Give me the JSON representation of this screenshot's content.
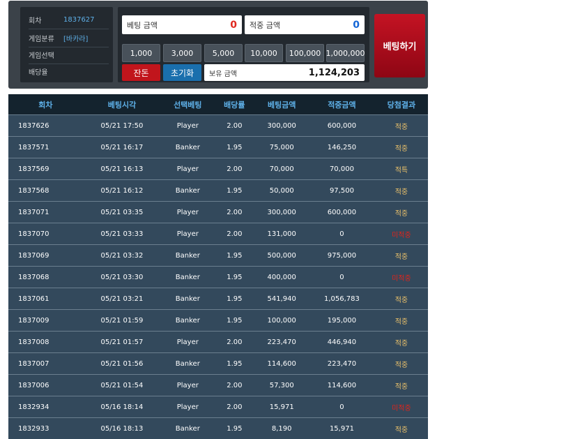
{
  "info": {
    "round_label": "회차",
    "round_value": "1837627",
    "game_type_label": "게임분류",
    "game_type_value": "[바카라]",
    "game_select_label": "게임선택",
    "odds_label": "배당율"
  },
  "bet": {
    "amount_label": "베팅 금액",
    "amount_value": "0",
    "win_label": "적중 금액",
    "win_value": "0",
    "chips": [
      "1,000",
      "3,000",
      "5,000",
      "10,000",
      "100,000",
      "1,000,000"
    ],
    "remainder_label": "잔돈",
    "reset_label": "초기화",
    "balance_label": "보유 금액",
    "balance_value": "1,124,203",
    "submit_label": "베팅하기"
  },
  "colors": {
    "amount_value": "#e0291f",
    "win_value": "#1466d6",
    "remainder_btn": "#c1151c",
    "reset_btn": "#1a6fad",
    "header_text": "#5eb0e8",
    "result_win": "#e9c06a",
    "result_loss": "#e3241a"
  },
  "history": {
    "headers": [
      "회차",
      "베팅시각",
      "선택베팅",
      "배당률",
      "베팅금액",
      "적중금액",
      "당첨결과"
    ],
    "rows": [
      {
        "round": "1837626",
        "time": "05/21 17:50",
        "pick": "Player",
        "odds": "2.00",
        "bet": "300,000",
        "win": "600,000",
        "result": "적중",
        "status": "win"
      },
      {
        "round": "1837571",
        "time": "05/21 16:17",
        "pick": "Banker",
        "odds": "1.95",
        "bet": "75,000",
        "win": "146,250",
        "result": "적중",
        "status": "win"
      },
      {
        "round": "1837569",
        "time": "05/21 16:13",
        "pick": "Player",
        "odds": "2.00",
        "bet": "70,000",
        "win": "70,000",
        "result": "적특",
        "status": "win"
      },
      {
        "round": "1837568",
        "time": "05/21 16:12",
        "pick": "Banker",
        "odds": "1.95",
        "bet": "50,000",
        "win": "97,500",
        "result": "적중",
        "status": "win"
      },
      {
        "round": "1837071",
        "time": "05/21 03:35",
        "pick": "Player",
        "odds": "2.00",
        "bet": "300,000",
        "win": "600,000",
        "result": "적중",
        "status": "win"
      },
      {
        "round": "1837070",
        "time": "05/21 03:33",
        "pick": "Player",
        "odds": "2.00",
        "bet": "131,000",
        "win": "0",
        "result": "미적중",
        "status": "loss"
      },
      {
        "round": "1837069",
        "time": "05/21 03:32",
        "pick": "Banker",
        "odds": "1.95",
        "bet": "500,000",
        "win": "975,000",
        "result": "적중",
        "status": "win"
      },
      {
        "round": "1837068",
        "time": "05/21 03:30",
        "pick": "Banker",
        "odds": "1.95",
        "bet": "400,000",
        "win": "0",
        "result": "미적중",
        "status": "loss"
      },
      {
        "round": "1837061",
        "time": "05/21 03:21",
        "pick": "Banker",
        "odds": "1.95",
        "bet": "541,940",
        "win": "1,056,783",
        "result": "적중",
        "status": "win"
      },
      {
        "round": "1837009",
        "time": "05/21 01:59",
        "pick": "Banker",
        "odds": "1.95",
        "bet": "100,000",
        "win": "195,000",
        "result": "적중",
        "status": "win"
      },
      {
        "round": "1837008",
        "time": "05/21 01:57",
        "pick": "Player",
        "odds": "2.00",
        "bet": "223,470",
        "win": "446,940",
        "result": "적중",
        "status": "win"
      },
      {
        "round": "1837007",
        "time": "05/21 01:56",
        "pick": "Banker",
        "odds": "1.95",
        "bet": "114,600",
        "win": "223,470",
        "result": "적중",
        "status": "win"
      },
      {
        "round": "1837006",
        "time": "05/21 01:54",
        "pick": "Player",
        "odds": "2.00",
        "bet": "57,300",
        "win": "114,600",
        "result": "적중",
        "status": "win"
      },
      {
        "round": "1832934",
        "time": "05/16 18:14",
        "pick": "Player",
        "odds": "2.00",
        "bet": "15,971",
        "win": "0",
        "result": "미적중",
        "status": "loss"
      },
      {
        "round": "1832933",
        "time": "05/16 18:13",
        "pick": "Banker",
        "odds": "1.95",
        "bet": "8,190",
        "win": "15,971",
        "result": "적중",
        "status": "win"
      }
    ]
  }
}
